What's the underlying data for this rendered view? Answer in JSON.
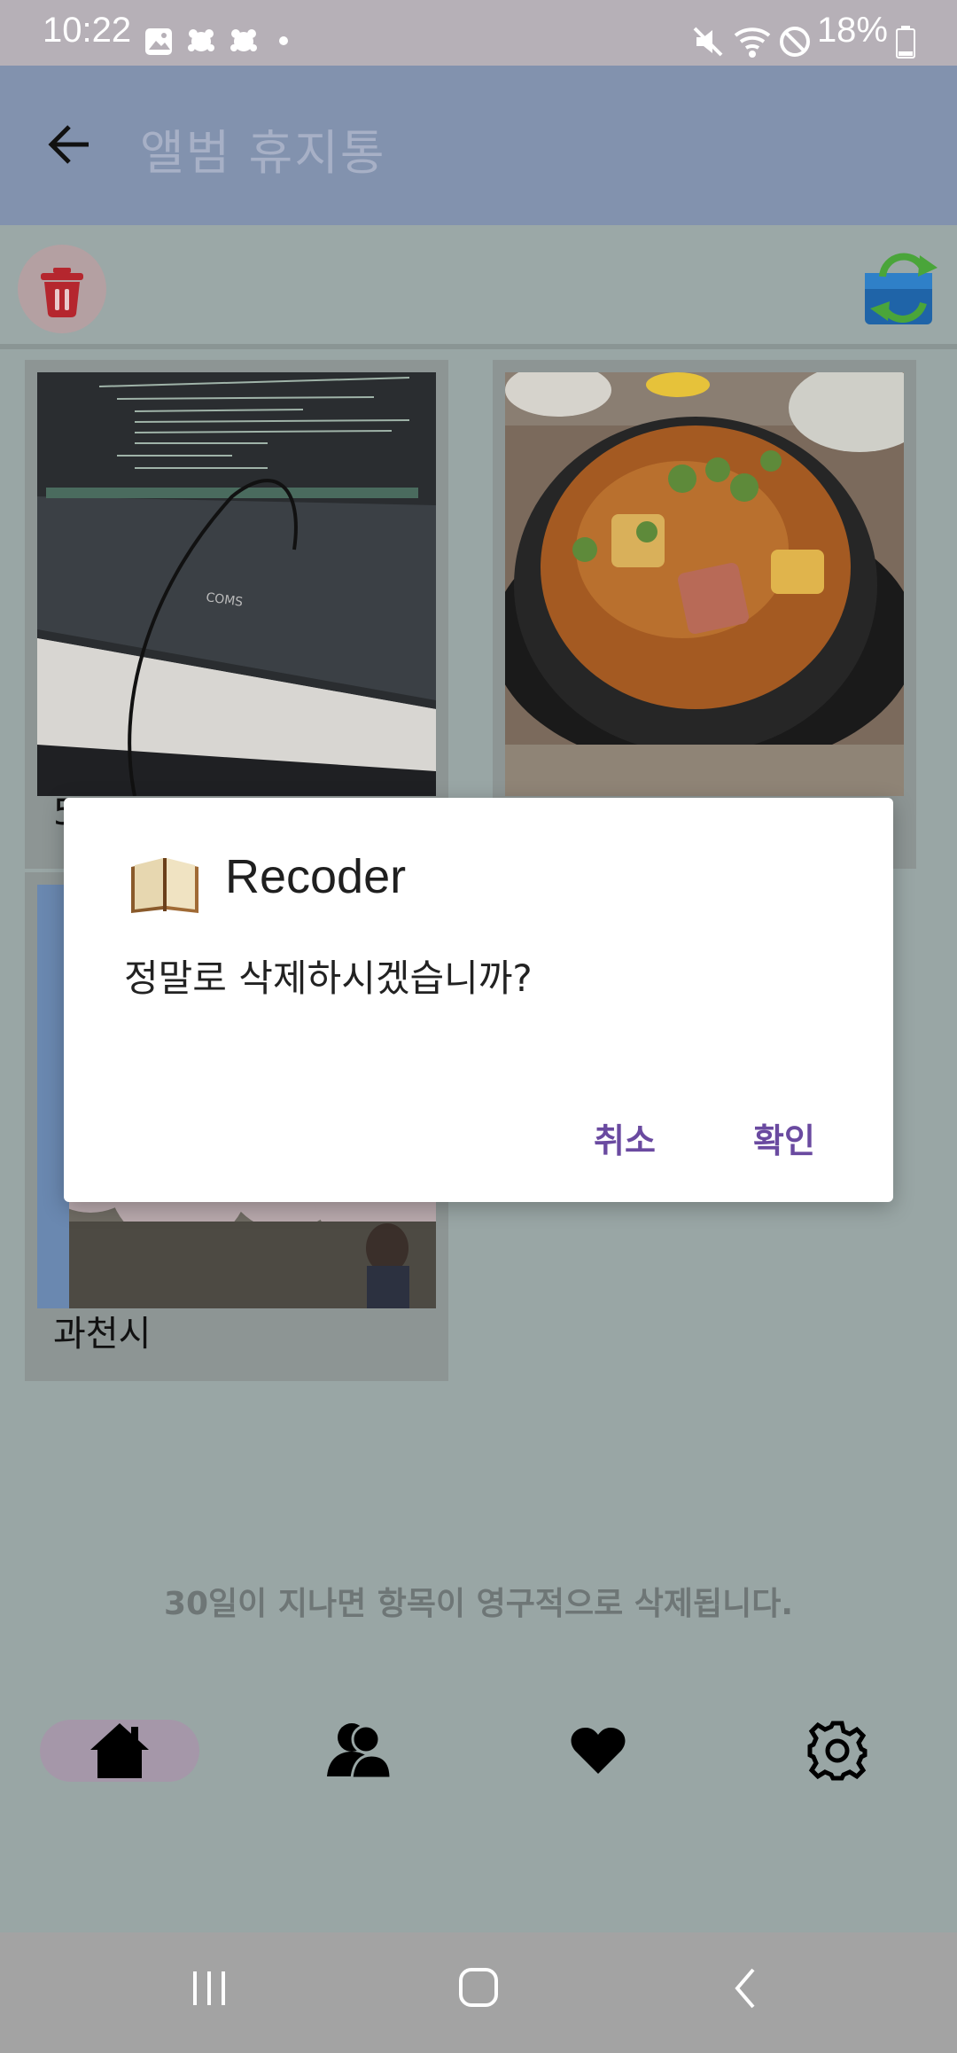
{
  "status_bar": {
    "time": "10:22",
    "battery": "18%"
  },
  "app_bar": {
    "title": "앨범 휴지통"
  },
  "cards": [
    {
      "label": "5"
    },
    {
      "label": ""
    },
    {
      "label": "과천시"
    }
  ],
  "retention_notice": "30일이 지나면 항목이 영구적으로 삭제됩니다.",
  "dialog": {
    "title": "Recoder",
    "message": "정말로 삭제하시겠습니까?",
    "cancel_label": "취소",
    "confirm_label": "확인"
  },
  "colors": {
    "app_bar": "#8292ae",
    "dialog_button": "#6a4aa0",
    "nav_active": "#a597a9"
  },
  "icons": [
    "back-arrow-icon",
    "trash-icon",
    "restore-icon",
    "home-icon",
    "friends-icon",
    "heart-icon",
    "settings-icon"
  ]
}
